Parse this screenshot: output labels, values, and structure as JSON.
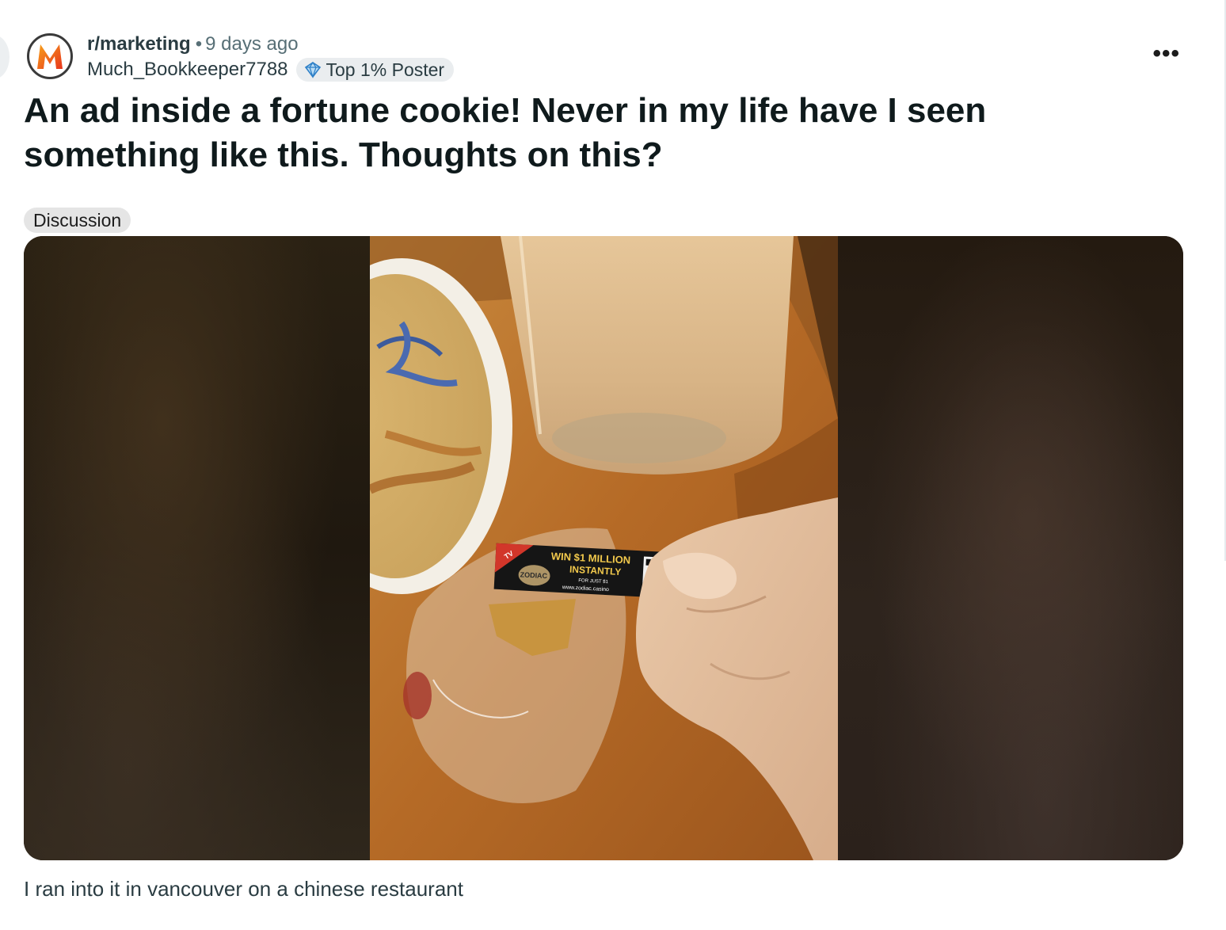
{
  "post": {
    "subreddit": "r/marketing",
    "separator": "•",
    "posted_ago": "9 days ago",
    "author": "Much_Bookkeeper7788",
    "author_flair": "Top 1% Poster",
    "title": "An ad inside a fortune cookie! Never in my life have I seen something like this. Thoughts on this?",
    "post_flair": "Discussion",
    "more_menu": "•••",
    "body": "I ran into it in vancouver on a chinese restaurant",
    "avatar_letter": "M"
  },
  "image": {
    "ad_badge": "AS SEEN ON TV",
    "ad_headline_1": "WIN $1 MILLION",
    "ad_headline_2": "INSTANTLY",
    "ad_subline": "FOR JUST $1",
    "ad_url": "www.zodiac.casino",
    "ad_logo": "ZODIAC",
    "ad_logo_sub": "CASINO"
  },
  "icons": {
    "avatar": "subreddit-avatar-m-icon",
    "flair": "top-poster-icon",
    "more": "more-options-icon"
  },
  "colors": {
    "avatar_orange": "#f47a20",
    "avatar_red": "#e8341c",
    "flair_bg": "#eaedef",
    "tag_bg": "#e5e5e5",
    "meta_gray": "#576f76"
  }
}
